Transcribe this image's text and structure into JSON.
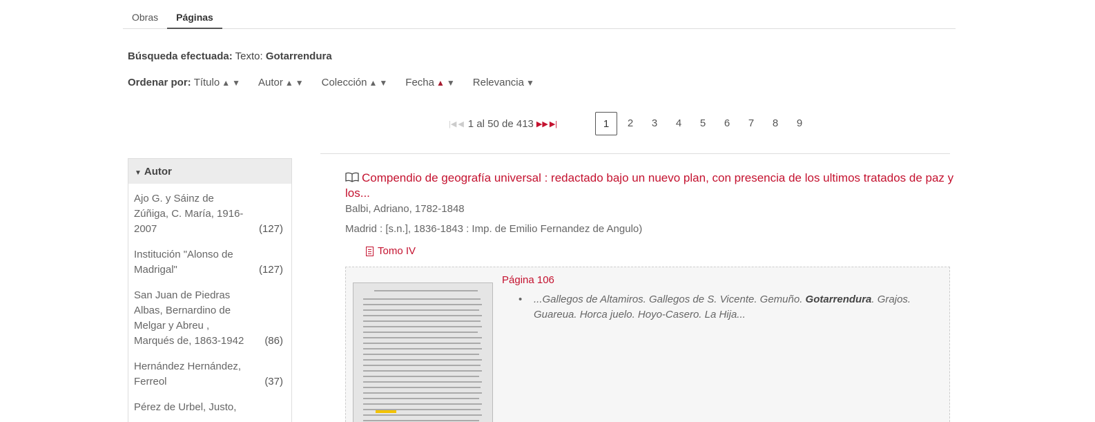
{
  "tabs": [
    {
      "label": "Obras",
      "active": false
    },
    {
      "label": "Páginas",
      "active": true
    }
  ],
  "search": {
    "label": "Búsqueda efectuada:",
    "field": "Texto:",
    "term": "Gotarrendura"
  },
  "sort": {
    "label": "Ordenar por:",
    "options": [
      "Título",
      "Autor",
      "Colección",
      "Fecha",
      "Relevancia"
    ],
    "active_option": "Fecha",
    "active_direction": "asc"
  },
  "pager": {
    "range": "1 al 50 de 413",
    "pages": [
      "1",
      "2",
      "3",
      "4",
      "5",
      "6",
      "7",
      "8",
      "9"
    ],
    "current": "1"
  },
  "facet": {
    "title": "Autor",
    "items": [
      {
        "name": "Ajo G. y Sáinz de Zúñiga, C. María, 1916-2007",
        "count": "(127)"
      },
      {
        "name": "Institución \"Alonso de Madrigal\"",
        "count": "(127)"
      },
      {
        "name": "San Juan de Piedras Albas, Bernardino de Melgar y Abreu , Marqués de, 1863-1942",
        "count": "(86)"
      },
      {
        "name": "Hernández Hernández, Ferreol",
        "count": "(37)"
      },
      {
        "name": "Pérez de Urbel, Justo,",
        "count": ""
      }
    ]
  },
  "result": {
    "title": "Compendio de geografía universal : redactado bajo un nuevo plan, con presencia de los ultimos tratados de paz y los...",
    "author": "Balbi, Adriano, 1782-1848",
    "publication": "Madrid : [s.n.], 1836-1843 : Imp. de Emilio Fernandez de Angulo)",
    "volume": "Tomo IV",
    "hit": {
      "page": "Página 106",
      "snippet_before": "...Gallegos de Altamiros. Gallegos de S. Vicente. Gemuño. ",
      "snippet_term": "Gotarrendura",
      "snippet_after": ". Grajos. Guareua. Horca juelo. Hoyo-Casero. La Hija..."
    }
  },
  "colors": {
    "link": "#c4122f",
    "active_sort_arrow": "#a51c30"
  }
}
